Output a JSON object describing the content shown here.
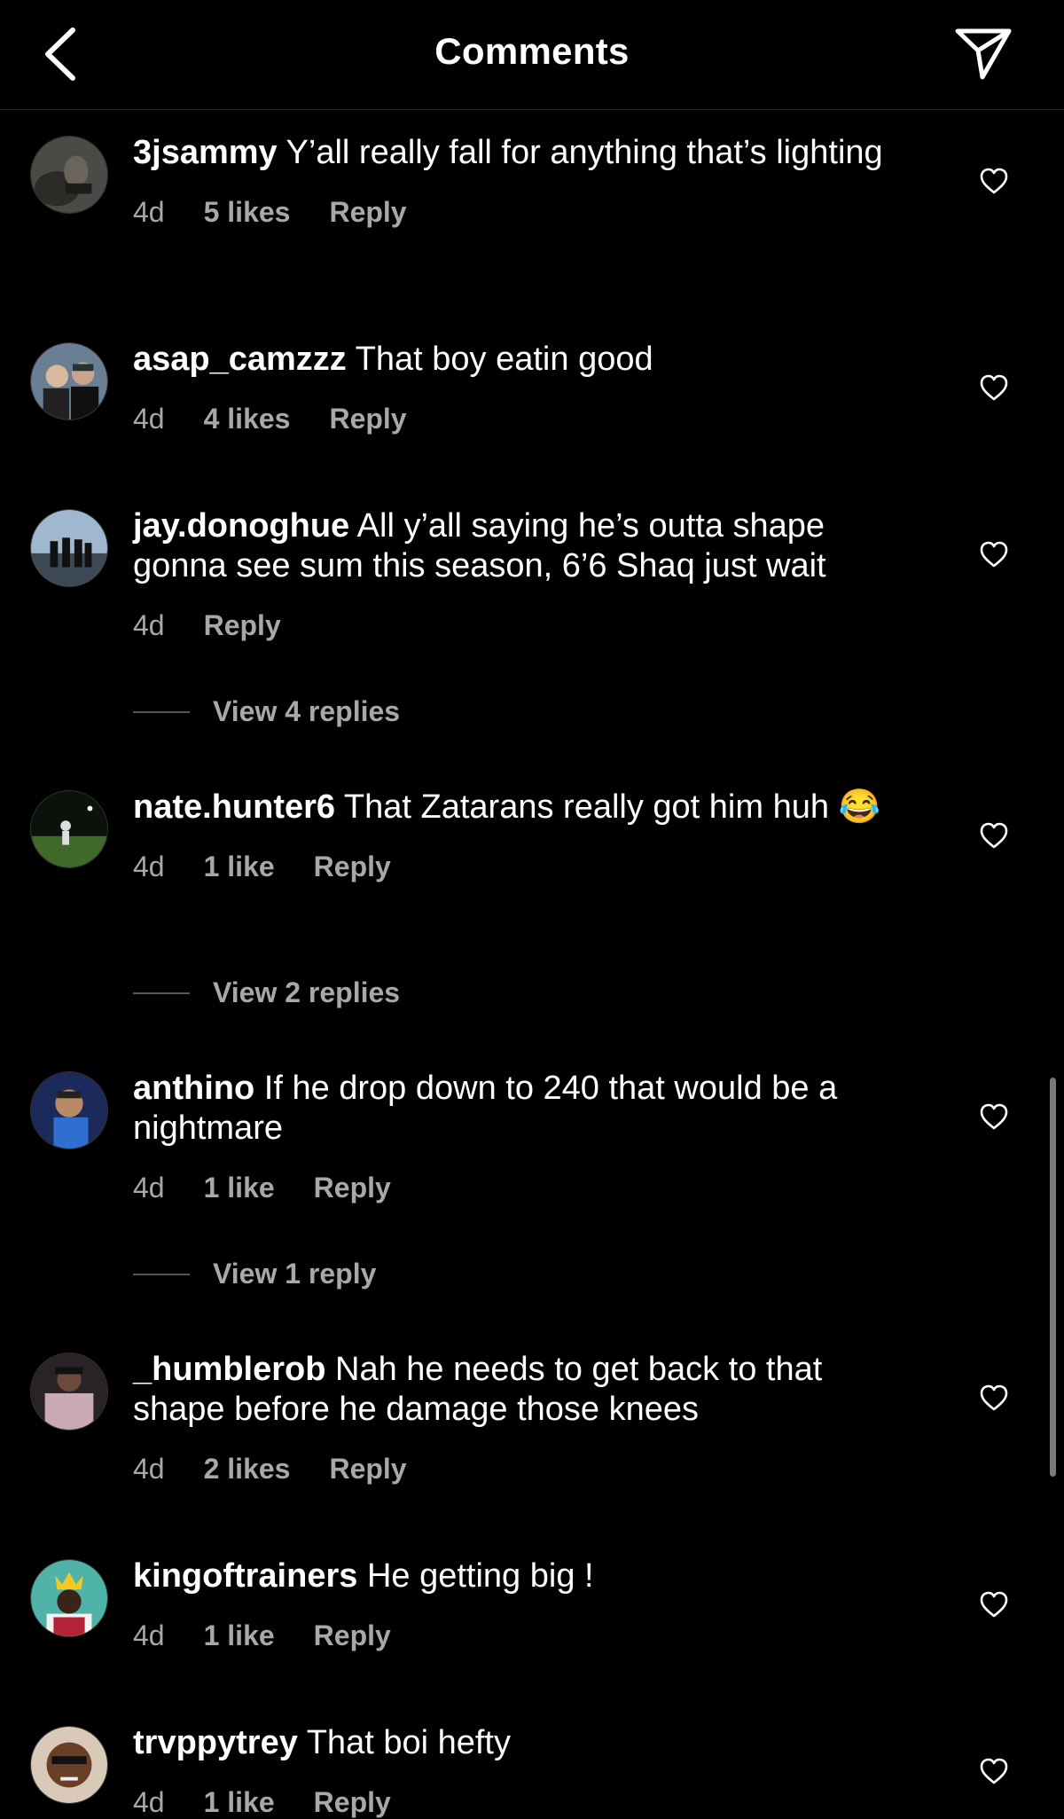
{
  "header": {
    "title": "Comments"
  },
  "comments": [
    {
      "user": "3jsammy",
      "text": "Y’all really fall for anything that’s lighting",
      "time": "4d",
      "likes": "5 likes",
      "reply": "Reply"
    },
    {
      "user": "asap_camzzz",
      "text": "That boy eatin good",
      "time": "4d",
      "likes": "4 likes",
      "reply": "Reply"
    },
    {
      "user": "jay.donoghue",
      "text": "All y’all saying he’s outta shape gonna see sum this season, 6’6 Shaq just wait",
      "time": "4d",
      "likes": "",
      "reply": "Reply",
      "view_replies": "View 4 replies"
    },
    {
      "user": "nate.hunter6",
      "text": "That Zatarans really got him huh 😂",
      "time": "4d",
      "likes": "1 like",
      "reply": "Reply",
      "view_replies": "View 2 replies"
    },
    {
      "user": "anthino",
      "text": "If he drop down to 240 that would be a nightmare",
      "time": "4d",
      "likes": "1 like",
      "reply": "Reply",
      "view_replies": "View 1 reply"
    },
    {
      "user": "_humblerob",
      "text": "Nah he needs to get back to that shape before he damage those knees",
      "time": "4d",
      "likes": "2 likes",
      "reply": "Reply"
    },
    {
      "user": "kingoftrainers",
      "text": "He getting big !",
      "time": "4d",
      "likes": "1 like",
      "reply": "Reply"
    },
    {
      "user": "trvppytrey",
      "text": "That boi hefty",
      "time": "4d",
      "likes": "1 like",
      "reply": "Reply"
    }
  ]
}
